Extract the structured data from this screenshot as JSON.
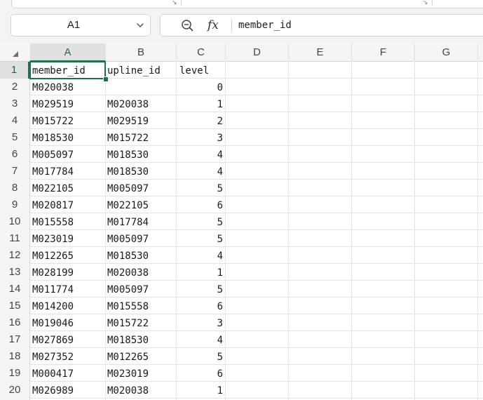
{
  "name_box": {
    "value": "A1"
  },
  "formula_bar": {
    "content": "member_id",
    "fx_label": "fx"
  },
  "icons": {
    "zoom": "zoom-icon",
    "chevron": "chevron-down-icon",
    "launcher": "dialog-launcher-icon"
  },
  "colors": {
    "accent": "#1e7145",
    "header_bg": "#f5f5f5",
    "grid_line": "#e4e4e4"
  },
  "columns": [
    "A",
    "B",
    "C",
    "D",
    "E",
    "F",
    "G"
  ],
  "rows": [
    "1",
    "2",
    "3",
    "4",
    "5",
    "6",
    "7",
    "8",
    "9",
    "10",
    "11",
    "12",
    "13",
    "14",
    "15",
    "16",
    "17",
    "18",
    "19",
    "20"
  ],
  "table": [
    [
      "member_id",
      "upline_id",
      "level"
    ],
    [
      "M020038",
      "",
      "0"
    ],
    [
      "M029519",
      "M020038",
      "1"
    ],
    [
      "M015722",
      "M029519",
      "2"
    ],
    [
      "M018530",
      "M015722",
      "3"
    ],
    [
      "M005097",
      "M018530",
      "4"
    ],
    [
      "M017784",
      "M018530",
      "4"
    ],
    [
      "M022105",
      "M005097",
      "5"
    ],
    [
      "M020817",
      "M022105",
      "6"
    ],
    [
      "M015558",
      "M017784",
      "5"
    ],
    [
      "M023019",
      "M005097",
      "5"
    ],
    [
      "M012265",
      "M018530",
      "4"
    ],
    [
      "M028199",
      "M020038",
      "1"
    ],
    [
      "M011774",
      "M005097",
      "5"
    ],
    [
      "M014200",
      "M015558",
      "6"
    ],
    [
      "M019046",
      "M015722",
      "3"
    ],
    [
      "M027869",
      "M018530",
      "4"
    ],
    [
      "M027352",
      "M012265",
      "5"
    ],
    [
      "M000417",
      "M023019",
      "6"
    ],
    [
      "M026989",
      "M020038",
      "1"
    ]
  ]
}
